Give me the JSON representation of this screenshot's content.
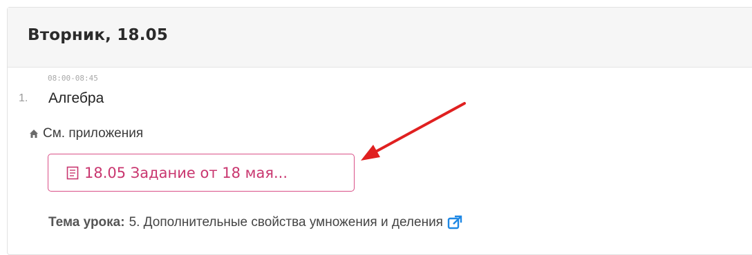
{
  "day": {
    "title": "Вторник, 18.05"
  },
  "lesson": {
    "time": "08:00-08:45",
    "number": "1.",
    "subject": "Алгебра",
    "homework_text": "См. приложения",
    "attachment_label": "18.05 Задание от 18 мая...",
    "theme_label": "Тема урока:",
    "theme_value": "5. Дополнительные свойства умножения и деления"
  },
  "colors": {
    "accent": "#c9366f",
    "annotation_arrow": "#e02020"
  },
  "icons": {
    "home": "home-icon",
    "attachment": "document-icon",
    "external_link": "external-link-icon"
  }
}
